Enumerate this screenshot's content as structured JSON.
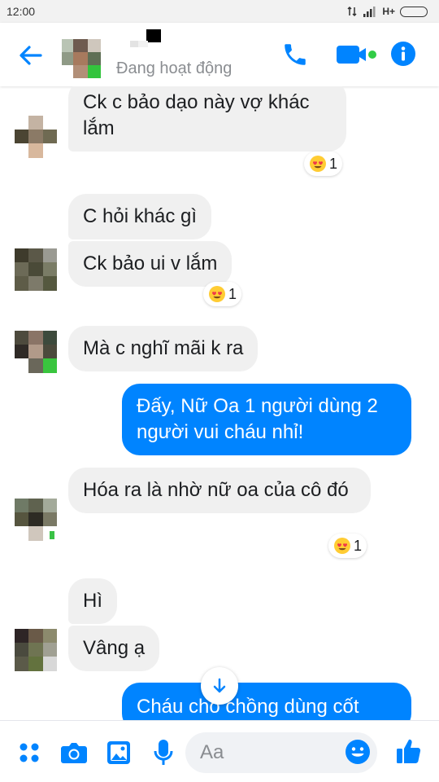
{
  "status_bar": {
    "time": "12:00",
    "network": "H+"
  },
  "header": {
    "active_status": "Đang hoạt động"
  },
  "messages": [
    {
      "text": "Ck c bảo dạo này vợ khác lắm",
      "reaction_count": "1"
    },
    {
      "text": "C hỏi khác gì"
    },
    {
      "text": "Ck bảo ui v lắm",
      "reaction_count": "1"
    },
    {
      "text": "Mà c nghĩ mãi k ra"
    },
    {
      "text": "Đấy, Nữ Oa 1 người dùng 2 người vui cháu nhỉ!"
    },
    {
      "text": "Hóa ra là nhờ nữ oa của cô đó",
      "reaction_count": "1"
    },
    {
      "text": "Hì"
    },
    {
      "text": "Vâng ạ"
    },
    {
      "text": "Cháu cho chồng dùng cốt"
    }
  ],
  "composer": {
    "placeholder": "Aa"
  },
  "colors": {
    "accent": "#0084ff",
    "incoming_bubble": "#f0f0f0",
    "active_dot": "#31cc46"
  }
}
